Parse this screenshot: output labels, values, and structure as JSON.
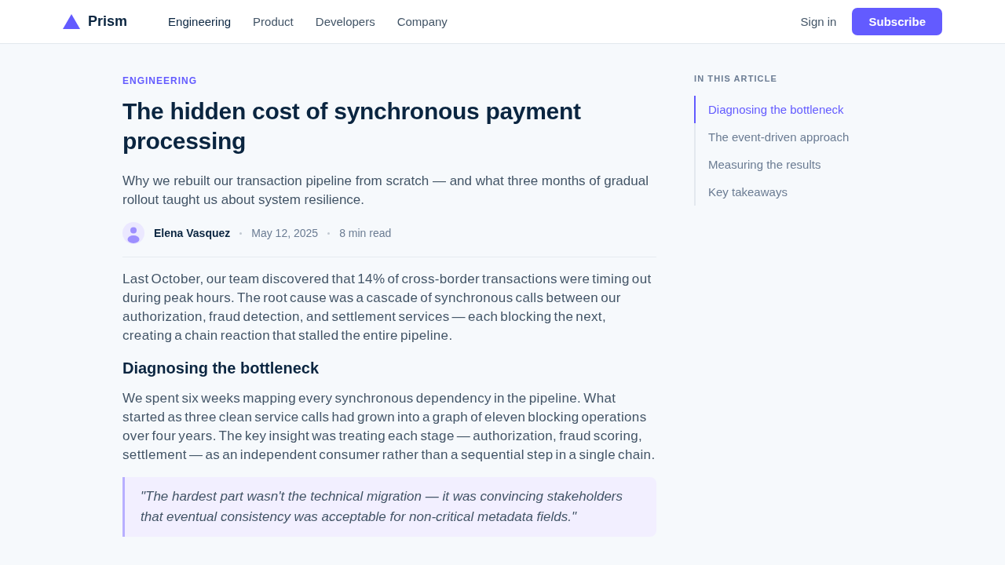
{
  "header": {
    "logo": "Prism",
    "nav": [
      {
        "label": "Engineering",
        "selected": true
      },
      {
        "label": "Product",
        "selected": false
      },
      {
        "label": "Developers",
        "selected": false
      },
      {
        "label": "Company",
        "selected": false
      }
    ],
    "sign_in": "Sign in",
    "subscribe": "Subscribe"
  },
  "article": {
    "category": "ENGINEERING",
    "title": "The hidden cost of synchronous payment processing",
    "subtitle": "Why we rebuilt our transaction pipeline from scratch — and what three months of gradual rollout taught us about system resilience.",
    "author": {
      "name": "Elena Vasquez",
      "date": "May 12, 2025",
      "read_time": "8 min read"
    },
    "body": [
      {
        "kind": "paragraph",
        "text": "Last October, our team discovered that 14% of cross-border transactions were timing out during peak hours. The root cause was a cascade of synchronous calls between our authorization, fraud detection, and settlement services — each blocking the next, creating a chain reaction that stalled the entire pipeline."
      },
      {
        "kind": "heading",
        "text": "Diagnosing the bottleneck"
      },
      {
        "kind": "paragraph",
        "text": "We spent six weeks mapping every synchronous dependency in the pipeline. What started as three clean service calls had grown into a graph of eleven blocking operations over four years. The key insight was treating each stage — authorization, fraud scoring, settlement — as an independent consumer rather than a sequential step in a single chain."
      },
      {
        "kind": "quote",
        "text": "\"The hardest part wasn't the technical migration — it was convincing stakeholders that eventual consistency was acceptable for non-critical metadata fields.\""
      }
    ]
  },
  "toc": {
    "title": "IN THIS ARTICLE",
    "items": [
      {
        "label": "Diagnosing the bottleneck",
        "selected": true
      },
      {
        "label": "The event-driven approach",
        "selected": false
      },
      {
        "label": "Measuring the results",
        "selected": false
      },
      {
        "label": "Key takeaways",
        "selected": false
      }
    ]
  }
}
